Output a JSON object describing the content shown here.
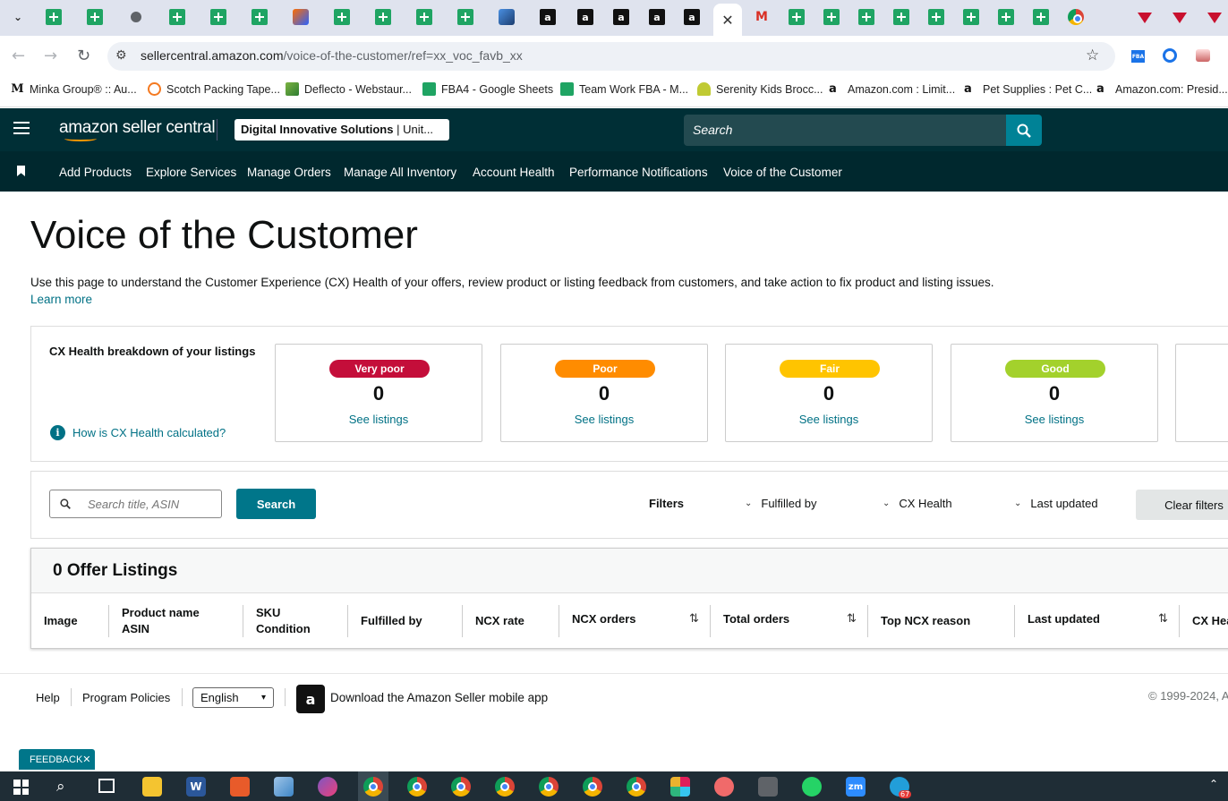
{
  "browser": {
    "url_host": "sellercentral.amazon.com",
    "url_path": "/voice-of-the-customer/ref=xx_voc_favb_xx",
    "active_tab_close": "✕",
    "bookmarks": [
      "Minka Group® :: Au...",
      "Scotch Packing Tape...",
      "Deflecto - Webstaur...",
      "FBA4 - Google Sheets",
      "Team Work FBA - M...",
      "Serenity Kids Brocc...",
      "Amazon.com : Limit...",
      "Pet Supplies : Pet C...",
      "Amazon.com: Presid..."
    ],
    "extension_label": "FBA"
  },
  "header": {
    "logo": "amazon seller central",
    "store_name": "Digital Innovative Solutions",
    "store_region": "| Unit...",
    "search_placeholder": "Search"
  },
  "nav": {
    "items": [
      "Add Products",
      "Explore Services",
      "Manage Orders",
      "Manage All Inventory",
      "Account Health",
      "Performance Notifications",
      "Voice of the Customer"
    ]
  },
  "page": {
    "title": "Voice of the Customer",
    "description": "Use this page to understand the Customer Experience (CX) Health of your offers, review product or listing feedback from customers, and take action to fix product and listing issues.",
    "learn_more": "Learn more"
  },
  "cx_health": {
    "label": "CX Health breakdown of your listings",
    "how_link": "How is CX Health calculated?",
    "cards": [
      {
        "status": "Very poor",
        "count": "0",
        "link": "See listings",
        "color": "#c40e3a",
        "text_color": "#ffffff"
      },
      {
        "status": "Poor",
        "count": "0",
        "link": "See listings",
        "color": "#ff8c00",
        "text_color": "#ffffff"
      },
      {
        "status": "Fair",
        "count": "0",
        "link": "See listings",
        "color": "#ffc400",
        "text_color": "#ffffff"
      },
      {
        "status": "Good",
        "count": "0",
        "link": "See listings",
        "color": "#a3d12c",
        "text_color": "#ffffff"
      }
    ]
  },
  "filters": {
    "search_placeholder": "Search title, ASIN",
    "search_button": "Search",
    "label": "Filters",
    "dropdowns": [
      "Fulfilled by",
      "CX Health",
      "Last updated"
    ],
    "clear": "Clear filters"
  },
  "table": {
    "title": "0 Offer Listings",
    "columns": [
      {
        "line1": "Image",
        "line2": ""
      },
      {
        "line1": "Product name",
        "line2": "ASIN"
      },
      {
        "line1": "SKU",
        "line2": "Condition"
      },
      {
        "line1": "Fulfilled by",
        "line2": ""
      },
      {
        "line1": "NCX rate",
        "line2": ""
      },
      {
        "line1": "NCX orders",
        "line2": ""
      },
      {
        "line1": "Total orders",
        "line2": ""
      },
      {
        "line1": "Top NCX reason",
        "line2": ""
      },
      {
        "line1": "Last updated",
        "line2": ""
      },
      {
        "line1": "CX Hea",
        "line2": ""
      }
    ]
  },
  "footer": {
    "help": "Help",
    "policies": "Program Policies",
    "language": "English",
    "app": "Download the Amazon Seller mobile app",
    "copyright": "© 1999-2024, A",
    "feedback": "FEEDBACK",
    "feedback_close": "✕"
  },
  "taskbar": {
    "telegram_badge": "67"
  }
}
